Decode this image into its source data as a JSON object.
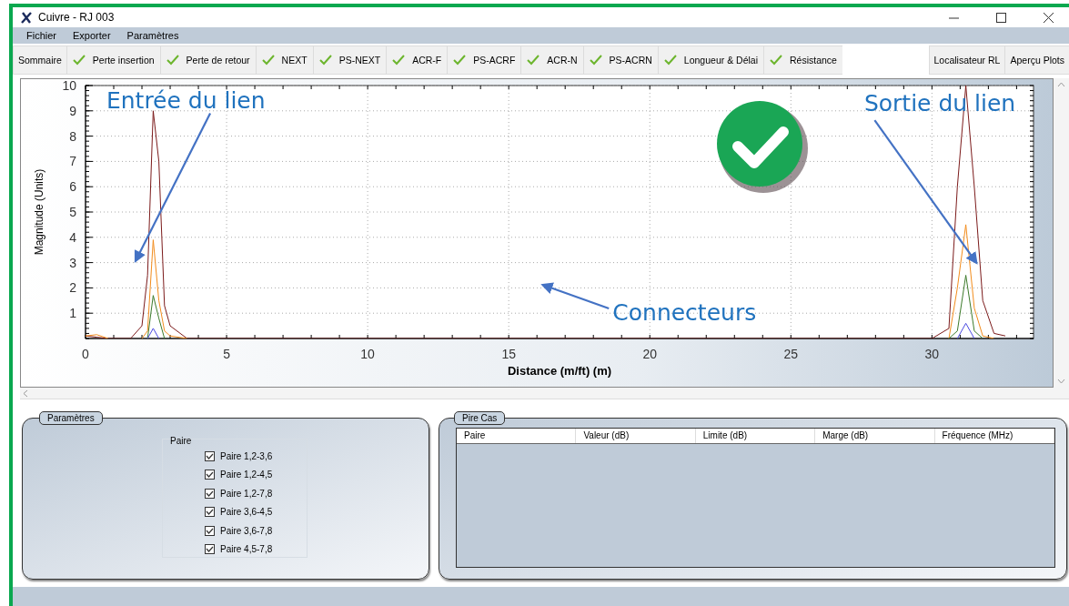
{
  "window": {
    "title": "Cuivre - RJ 003"
  },
  "menu": [
    "Fichier",
    "Exporter",
    "Paramètres"
  ],
  "toolbar": [
    {
      "label": "Sommaire",
      "passed": false
    },
    {
      "label": "Perte insertion",
      "passed": true
    },
    {
      "label": "Perte de retour",
      "passed": true
    },
    {
      "label": "NEXT",
      "passed": true
    },
    {
      "label": "PS-NEXT",
      "passed": true
    },
    {
      "label": "ACR-F",
      "passed": true
    },
    {
      "label": "PS-ACRF",
      "passed": true
    },
    {
      "label": "ACR-N",
      "passed": true
    },
    {
      "label": "PS-ACRN",
      "passed": true
    },
    {
      "label": "Longueur & Délai",
      "passed": true
    },
    {
      "label": "Résistance",
      "passed": true
    }
  ],
  "toolbar_right": [
    "Localisateur RL",
    "Aperçu Plots"
  ],
  "chart": {
    "chart_data": {
      "type": "line",
      "xlabel": "Distance (m/ft) (m)",
      "ylabel": "Magnitude (Units)",
      "x": [
        0,
        0.4,
        0.8,
        1.6,
        2.0,
        2.2,
        2.4,
        2.6,
        2.8,
        3.0,
        3.6,
        30.0,
        30.6,
        30.9,
        31.2,
        31.5,
        31.8,
        32.2,
        32.6
      ],
      "series": [
        {
          "color": "#7b1a1a",
          "values": [
            0.1,
            0.05,
            0,
            0,
            0.5,
            2.5,
            9,
            7,
            1.3,
            0.5,
            0,
            0,
            0.4,
            6,
            10,
            6,
            1.5,
            0.2,
            0.1
          ]
        },
        {
          "color": "#f28c1c",
          "values": [
            0.1,
            0.15,
            0,
            null,
            0,
            0.3,
            3.9,
            1.5,
            0.3,
            0.1,
            0,
            null,
            0,
            2,
            4.5,
            1.2,
            0.1,
            0,
            null
          ]
        },
        {
          "color": "#3c7a2a",
          "values": [
            null,
            null,
            null,
            null,
            null,
            0,
            1.7,
            0.8,
            0,
            null,
            null,
            null,
            0,
            0.3,
            2.5,
            0.3,
            0,
            null,
            null
          ]
        },
        {
          "color": "#4a4ae0",
          "values": [
            null,
            null,
            null,
            null,
            null,
            0,
            0.4,
            0,
            null,
            null,
            null,
            null,
            null,
            0,
            0.6,
            0,
            null,
            null,
            null
          ]
        }
      ],
      "xlim": [
        0,
        33.6
      ],
      "ylim": [
        0,
        10
      ],
      "xticks": [
        0,
        5,
        10,
        15,
        20,
        25,
        30
      ],
      "yticks": [
        1,
        2,
        3,
        4,
        5,
        6,
        7,
        8,
        9,
        10
      ],
      "grid": true,
      "annotations": [
        "Entrée du lien",
        "Sortie du lien",
        "Connecteurs"
      ]
    }
  },
  "parametres": {
    "title": "Paramètres",
    "group_label": "Paire",
    "pairs": [
      {
        "label": "Paire 1,2-3,6",
        "checked": true
      },
      {
        "label": "Paire 1,2-4,5",
        "checked": true
      },
      {
        "label": "Paire 1,2-7,8",
        "checked": true
      },
      {
        "label": "Paire 3,6-4,5",
        "checked": true
      },
      {
        "label": "Paire 3,6-7,8",
        "checked": true
      },
      {
        "label": "Paire 4,5-7,8",
        "checked": true
      }
    ]
  },
  "pire_cas": {
    "title": "Pire Cas",
    "columns": [
      "Paire",
      "Valeur (dB)",
      "Limite (dB)",
      "Marge (dB)",
      "Fréquence (MHz)"
    ]
  }
}
